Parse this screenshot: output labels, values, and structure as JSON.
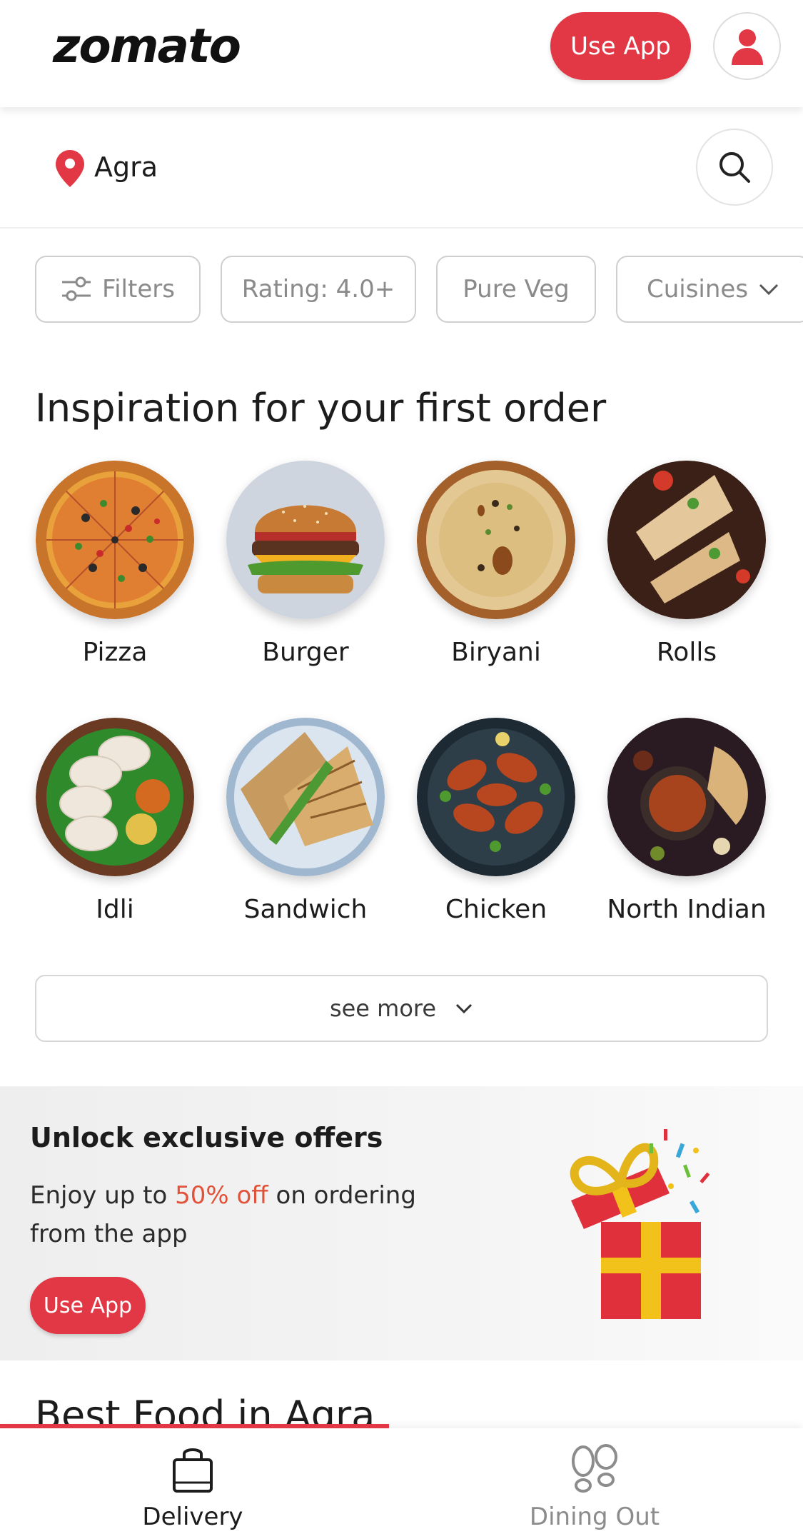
{
  "header": {
    "logo": "zomato",
    "use_app_label": "Use App"
  },
  "location": {
    "city": "Agra"
  },
  "filters": [
    {
      "label": "Filters",
      "icon": "sliders-icon"
    },
    {
      "label": "Rating: 4.0+"
    },
    {
      "label": "Pure Veg"
    },
    {
      "label": "Cuisines",
      "icon": "chevron-down-icon"
    }
  ],
  "inspiration": {
    "title": "Inspiration for your first order",
    "items": [
      {
        "label": "Pizza"
      },
      {
        "label": "Burger"
      },
      {
        "label": "Biryani"
      },
      {
        "label": "Rolls"
      },
      {
        "label": "Idli"
      },
      {
        "label": "Sandwich"
      },
      {
        "label": "Chicken"
      },
      {
        "label": "North Indian"
      }
    ],
    "see_more_label": "see more"
  },
  "offer": {
    "title": "Unlock exclusive offers",
    "desc_prefix": "Enjoy up to ",
    "desc_highlight": "50% off",
    "desc_suffix": " on ordering from the app",
    "button_label": "Use App"
  },
  "best_food": {
    "title": "Best Food in Agra"
  },
  "bottom_nav": {
    "delivery_label": "Delivery",
    "dining_label": "Dining Out"
  },
  "colors": {
    "brand": "#e23744",
    "highlight": "#e0533a"
  }
}
